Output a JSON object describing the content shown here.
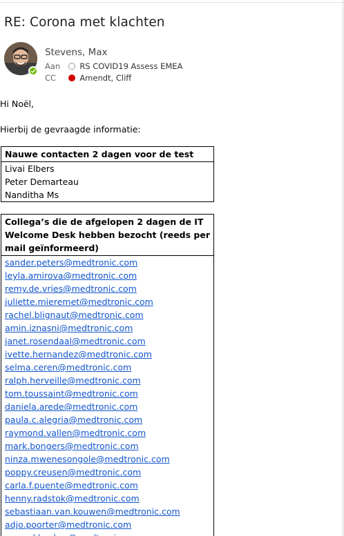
{
  "email": {
    "subject": "RE: Corona met klachten",
    "sender": "Stevens, Max",
    "to_label": "Aan",
    "to_value": "RS COVID19 Assess EMEA",
    "cc_label": "CC",
    "cc_value": "Amendt, Cliff",
    "greeting": "Hi Noël,",
    "intro": "Hierbij de gevraagde informatie:"
  },
  "colors": {
    "link": "#1155cc",
    "presence_available": "#6bb700",
    "presence_busy": "#d20000"
  },
  "table_contacts": {
    "header": "Nauwe contacten 2 dagen voor de test",
    "rows": [
      "Livai Elbers",
      "Peter Demarteau",
      "Nanditha Ms"
    ]
  },
  "table_visitors": {
    "header": "Collega’s die de afgelopen 2 dagen de IT Welcome Desk hebben bezocht (reeds per mail geïnformeerd)",
    "emails": [
      "sander.peters@medtronic.com",
      "leyla.amirova@medtronic.com",
      "remy.de.vries@medtronic.com",
      "juliette.mieremet@medtronic.com",
      "rachel.blignaut@medtronic.com",
      "amin.iznasni@medtronic.com",
      "janet.rosendaal@medtronic.com",
      "ivette.hernandez@medtronic.com",
      "selma.ceren@medtronic.com",
      "ralph.herveille@medtronic.com",
      "tom.toussaint@medtronic.com",
      "daniela.arede@medtronic.com",
      "paula.c.alegria@medtronic.com",
      "raymond.vallen@medtronic.com",
      "mark.bongers@medtronic.com",
      "ninza.mwenesongole@medtronic.com",
      "poppy.creusen@medtronic.com",
      "carla.f.puente@medtronic.com",
      "henny.radstok@medtronic.com",
      "sebastiaan.van.kouwen@medtronic.com",
      "adjo.poorter@medtronic.com",
      "arnoud.backus@medtronic.com"
    ]
  }
}
